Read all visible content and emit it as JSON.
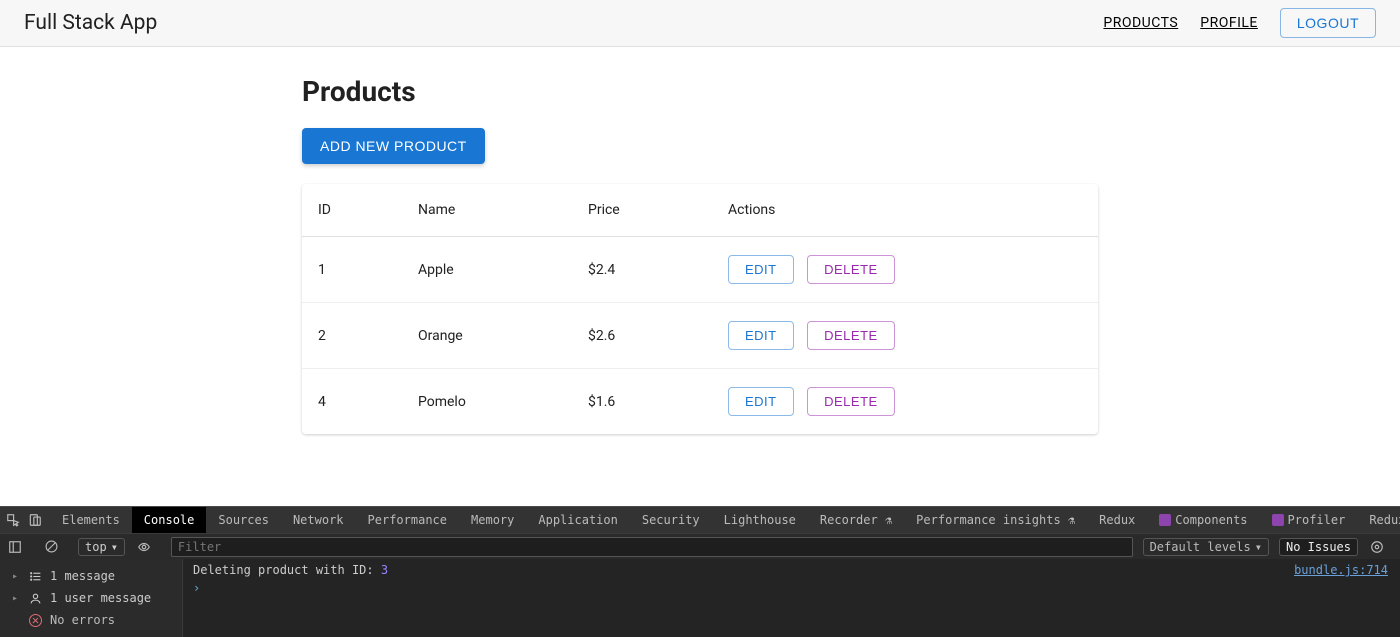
{
  "header": {
    "title": "Full Stack App",
    "nav": {
      "products": "PRODUCTS",
      "profile": "PROFILE",
      "logout": "LOGOUT"
    }
  },
  "page": {
    "heading": "Products",
    "add_button": "ADD NEW PRODUCT"
  },
  "table": {
    "columns": {
      "id": "ID",
      "name": "Name",
      "price": "Price",
      "actions": "Actions"
    },
    "edit_label": "EDIT",
    "delete_label": "DELETE",
    "rows": [
      {
        "id": "1",
        "name": "Apple",
        "price": "$2.4"
      },
      {
        "id": "2",
        "name": "Orange",
        "price": "$2.6"
      },
      {
        "id": "4",
        "name": "Pomelo",
        "price": "$1.6"
      }
    ]
  },
  "devtools": {
    "tabs": [
      "Elements",
      "Console",
      "Sources",
      "Network",
      "Performance",
      "Memory",
      "Application",
      "Security",
      "Lighthouse",
      "Recorder",
      "Performance insights",
      "Redux",
      "Components",
      "Profiler",
      "Redux"
    ],
    "active_tab": "Console",
    "context": "top",
    "filter_placeholder": "Filter",
    "levels_label": "Default levels",
    "issues_label": "No Issues",
    "sidebar": {
      "messages": "1 message",
      "user_messages": "1 user message",
      "errors": "No errors"
    },
    "console": {
      "text": "Deleting product with ID: ",
      "value": "3",
      "source": "bundle.js:714"
    }
  }
}
